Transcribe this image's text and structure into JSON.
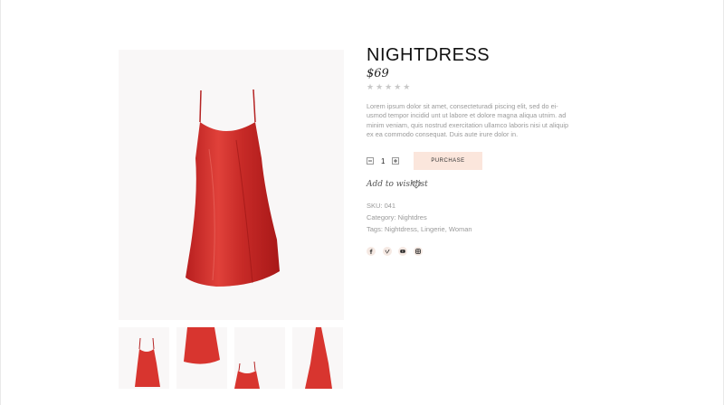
{
  "product": {
    "title": "NIGHTDRESS",
    "price": "$69",
    "rating_stars": "★★★★★",
    "description": "Lorem ipsum dolor sit amet, consecteturadi piscing elit, sed do ei-usmod tempor incidid unt ut labore et dolore magna aliqua utnim. ad minim veniam, quis nostrud exercitation ullamco laboris nisi ut aliquip ex ea commodo consequat. Duis aute irure dolor in.",
    "quantity": "1",
    "purchase_label": "PURCHASE",
    "wishlist_label": "Add to wishlist",
    "sku": "SKU: 041",
    "category": "Category: Nightdres",
    "tags": "Tags: Nightdress, Lingerie, Woman"
  },
  "colors": {
    "dress_red": "#d8352f",
    "purchase_bg": "#fbe6dc",
    "image_bg": "#f9f7f7"
  },
  "icons": {
    "minus": "minus-icon",
    "plus": "plus-icon",
    "heart": "heart-icon",
    "social": [
      "facebook-icon",
      "vimeo-icon",
      "youtube-icon",
      "instagram-icon"
    ]
  }
}
